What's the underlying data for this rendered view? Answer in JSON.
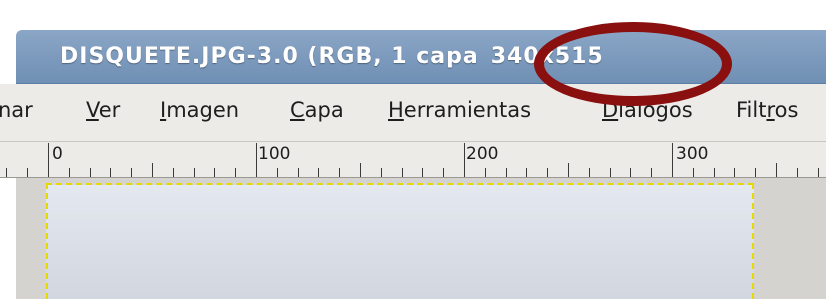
{
  "window": {
    "title_name": "DISQUETE.JPG-3.0 (RGB, 1 capa",
    "title_size": "340x515"
  },
  "menubar": {
    "items": [
      {
        "name": "seleccionar",
        "pre": "nar",
        "mnemonic": "",
        "post": ""
      },
      {
        "name": "ver",
        "pre": "",
        "mnemonic": "V",
        "post": "er"
      },
      {
        "name": "imagen",
        "pre": "",
        "mnemonic": "I",
        "post": "magen"
      },
      {
        "name": "capa",
        "pre": "",
        "mnemonic": "C",
        "post": "apa"
      },
      {
        "name": "herramientas",
        "pre": "",
        "mnemonic": "H",
        "post": "erramientas"
      },
      {
        "name": "dialogos",
        "pre": "",
        "mnemonic": "D",
        "post": "iálogos"
      },
      {
        "name": "filtros",
        "pre": "Filt",
        "mnemonic": "r",
        "post": "os"
      }
    ]
  },
  "ruler": {
    "labels": [
      "0",
      "100",
      "200",
      "300"
    ]
  },
  "annotation": {
    "highlight_color": "#8a1010"
  }
}
